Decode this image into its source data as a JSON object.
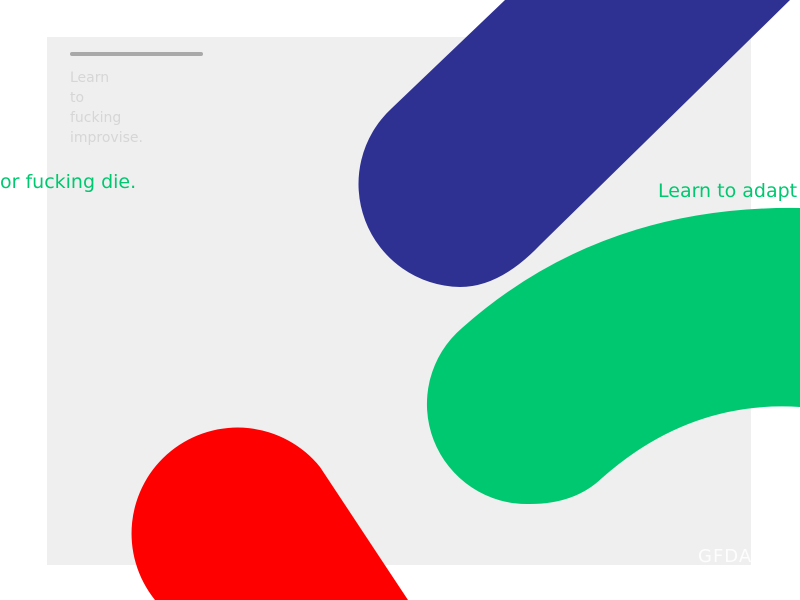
{
  "stacked_text": [
    "Learn",
    "to",
    "fucking",
    "improvise."
  ],
  "left_phrase": "or fucking die.",
  "right_phrase": "Learn to adapt",
  "watermark": "GFDA",
  "colors": {
    "blue": "#2e3192",
    "green": "#00c870",
    "red": "#ff0000",
    "panel": "#efefef"
  }
}
